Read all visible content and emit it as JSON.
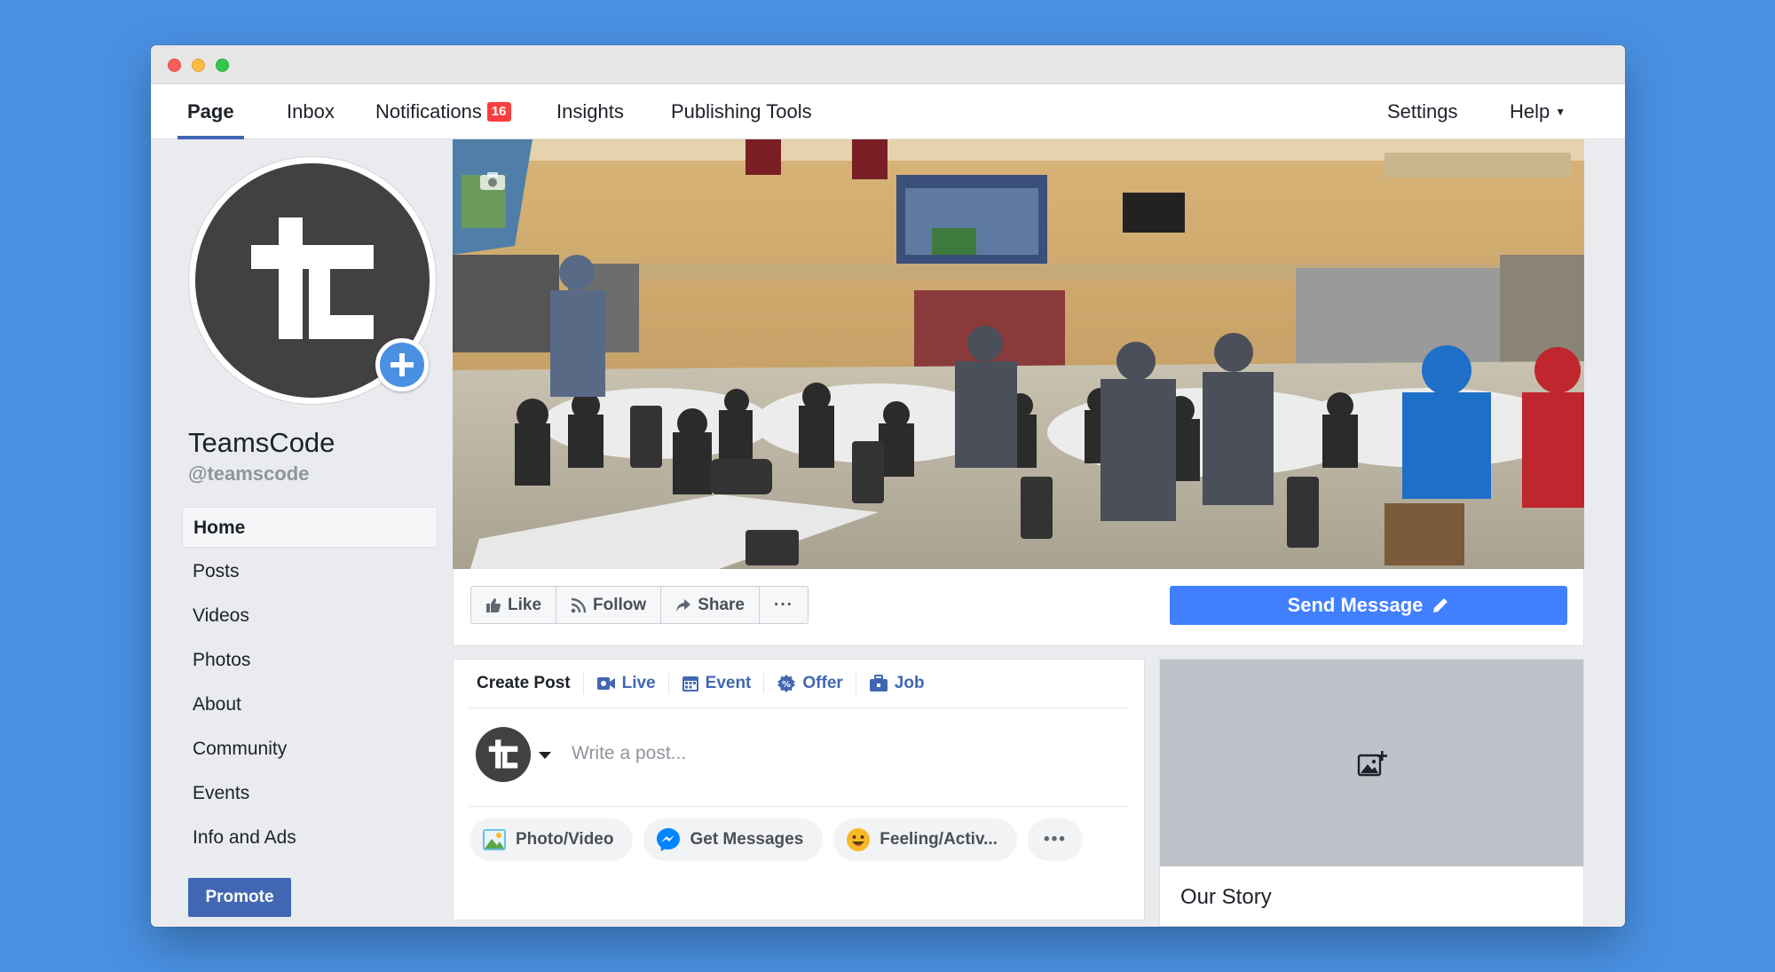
{
  "topnav": {
    "tabs": [
      {
        "label": "Page"
      },
      {
        "label": "Inbox"
      },
      {
        "label": "Notifications",
        "badge": "16"
      },
      {
        "label": "Insights"
      },
      {
        "label": "Publishing Tools"
      }
    ],
    "settings": "Settings",
    "help": "Help"
  },
  "profile": {
    "name": "TeamsCode",
    "handle": "@teamscode",
    "logo_color": "#414141"
  },
  "leftnav": {
    "items": [
      "Home",
      "Posts",
      "Videos",
      "Photos",
      "About",
      "Community",
      "Events",
      "Info and Ads"
    ],
    "promote": "Promote"
  },
  "actions": {
    "like": "Like",
    "follow": "Follow",
    "share": "Share",
    "more": "···",
    "send_message": "Send Message"
  },
  "composer": {
    "tabs": [
      "Create Post",
      "Live",
      "Event",
      "Offer",
      "Job"
    ],
    "placeholder": "Write a post...",
    "chips": [
      "Photo/Video",
      "Get Messages",
      "Feeling/Activ..."
    ],
    "more": "•••"
  },
  "story": {
    "title": "Our Story"
  },
  "colors": {
    "fb_blue": "#4267b2",
    "send_blue": "#4080ff",
    "background": "#4a90e2"
  }
}
